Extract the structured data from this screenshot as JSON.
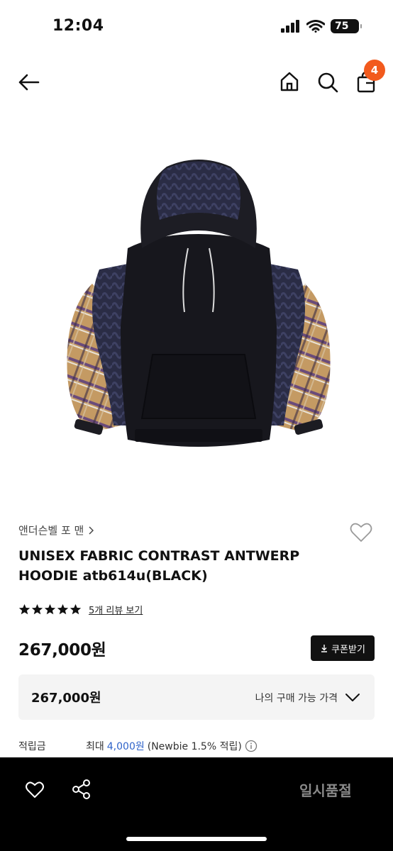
{
  "status_bar": {
    "time": "12:04",
    "battery": "75"
  },
  "nav": {
    "cart_count": "4",
    "icons": [
      "back-arrow-icon",
      "home-icon",
      "search-icon",
      "shopping-bag-icon"
    ]
  },
  "product": {
    "brand": "앤더슨벨 포 맨",
    "title": "UNISEX FABRIC CONTRAST ANTWERP HOODIE atb614u(BLACK)",
    "rating": 5,
    "review_link": "5개 리뷰 보기",
    "price": "267,000원",
    "coupon_button": "쿠폰받기",
    "my_price_value": "267,000원",
    "my_price_label": "나의 구매 가능 가격",
    "points_label": "적립금",
    "points_prefix": "최대",
    "points_amount": "4,000원",
    "points_suffix": "(Newbie 1.5% 적립)"
  },
  "bottom_bar": {
    "status": "일시품절",
    "icons": [
      "heart-icon",
      "share-icon"
    ]
  },
  "colors": {
    "accent": "#f25a1d",
    "link_blue": "#2f63c9",
    "bottom_bar_bg": "#000000"
  }
}
